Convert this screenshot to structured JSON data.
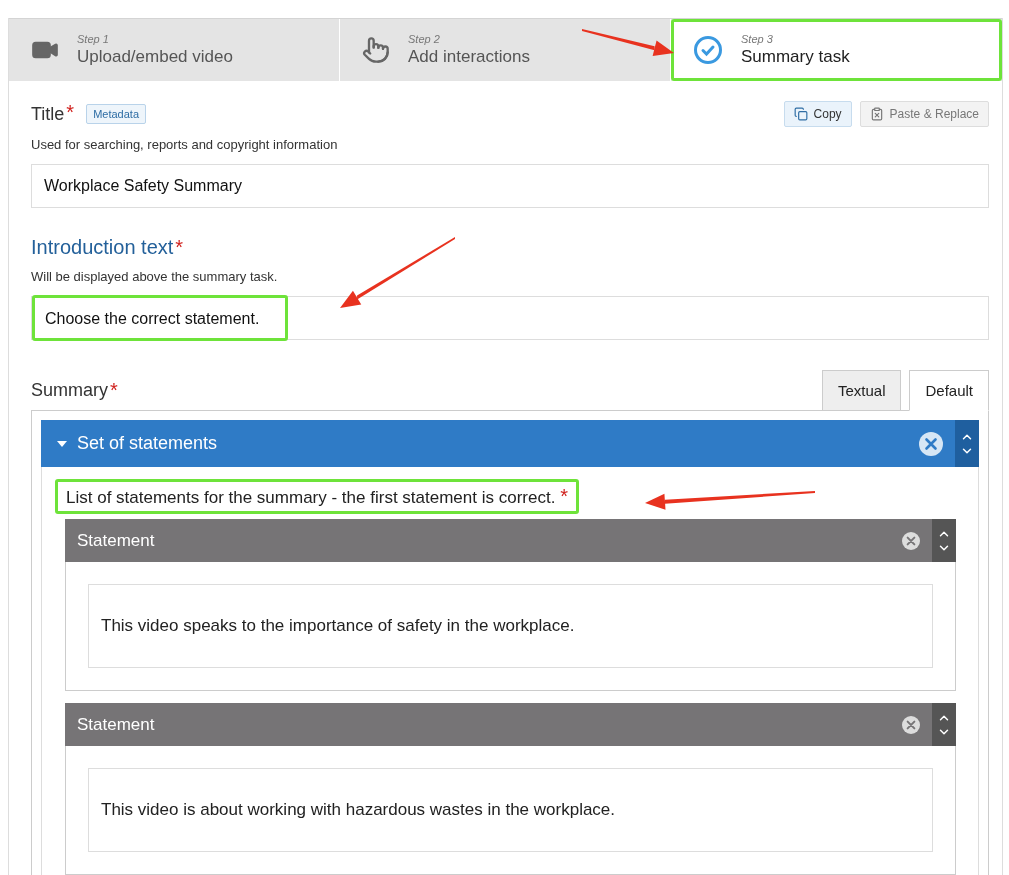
{
  "steps": [
    {
      "kind": "video",
      "label": "Step 1",
      "title": "Upload/embed video",
      "selected": false,
      "highlighted": false
    },
    {
      "kind": "touch",
      "label": "Step 2",
      "title": "Add interactions",
      "selected": false,
      "highlighted": false
    },
    {
      "kind": "check",
      "label": "Step 3",
      "title": "Summary task",
      "selected": true,
      "highlighted": true
    }
  ],
  "title_field": {
    "label": "Title",
    "required_mark": "*",
    "tag": "Metadata",
    "description": "Used for searching, reports and copyright information",
    "value": "Workplace Safety Summary"
  },
  "actions": [
    {
      "kind": "copy",
      "label": "Copy",
      "disabled": false
    },
    {
      "kind": "paste",
      "label": "Paste & Replace",
      "disabled": true
    }
  ],
  "intro_field": {
    "label": "Introduction text",
    "required_mark": "*",
    "description": "Will be displayed above the summary task.",
    "value": "Choose the correct statement.",
    "highlighted": true
  },
  "summary": {
    "label": "Summary",
    "required_mark": "*",
    "tabs": [
      {
        "label": "Textual",
        "selected": false
      },
      {
        "label": "Default",
        "selected": true
      }
    ],
    "group": {
      "title": "Set of statements",
      "expanded": true,
      "description": "List of statements for the summary - the first statement is correct.",
      "required_mark": "*",
      "highlighted": true,
      "statements": [
        {
          "title": "Statement",
          "text": "This video speaks to the importance of safety in the workplace."
        },
        {
          "title": "Statement",
          "text": "This video is about working with hazardous wastes in the workplace."
        }
      ]
    }
  }
}
